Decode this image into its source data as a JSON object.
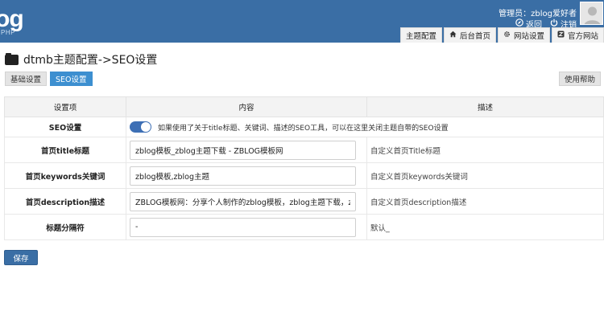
{
  "header": {
    "logo_text": "og",
    "logo_sub": "PHP",
    "admin_label": "管理员：zblog爱好者",
    "back_label": "返回",
    "logout_label": "注销",
    "brand_color": "#3a6ea5",
    "nav_tabs": [
      {
        "label": "主题配置",
        "icon": ""
      },
      {
        "label": "后台首页",
        "icon": "home-icon"
      },
      {
        "label": "网站设置",
        "icon": "gear-icon"
      },
      {
        "label": "官方网站",
        "icon": "zblog-icon"
      }
    ]
  },
  "page": {
    "title": "dtmb主题配置->SEO设置",
    "sub_tabs": [
      "基础设置",
      "SEO设置"
    ],
    "active_sub_tab": "SEO设置",
    "help_label": "使用帮助"
  },
  "table": {
    "headers": [
      "设置项",
      "内容",
      "描述"
    ],
    "seo_row": {
      "label": "SEO设置",
      "toggle_on": true,
      "description": "如果使用了关于title标题、关键词、描述的SEO工具，可以在这里关闭主题自带的SEO设置"
    },
    "rows": [
      {
        "label": "首页title标题",
        "value": "zblog模板_zblog主题下载 - ZBLOG模板网",
        "desc": "自定义首页Title标题"
      },
      {
        "label": "首页keywords关键词",
        "value": "zblog模板,zblog主题",
        "desc": "自定义首页keywords关键词"
      },
      {
        "label": "首页description描述",
        "value": "ZBLOG模板网：分享个人制作的zblog模板，zblog主题下载，zblog相关",
        "desc": "自定义首页description描述"
      },
      {
        "label": "标题分隔符",
        "value": "-",
        "desc": "默认_"
      }
    ]
  },
  "actions": {
    "save_label": "保存"
  }
}
